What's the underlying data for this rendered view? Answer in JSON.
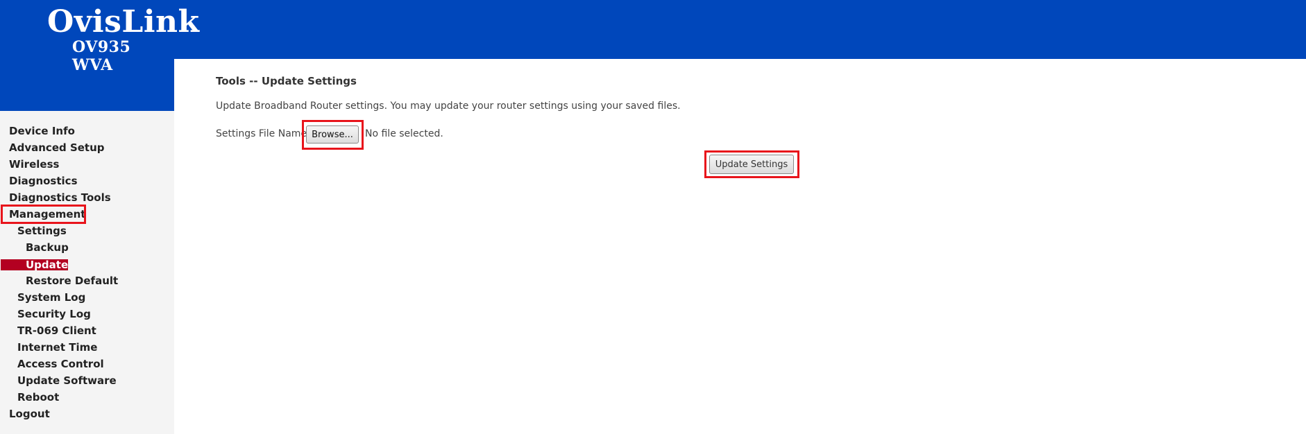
{
  "brand": {
    "name": "OvisLink",
    "model": "OV935 WVA",
    "header_color": "#0047bb"
  },
  "sidebar": {
    "selected_color": "#b30021",
    "highlight_color": "#e8141b",
    "items": [
      {
        "label": "Device Info",
        "level": 0
      },
      {
        "label": "Advanced Setup",
        "level": 0
      },
      {
        "label": "Wireless",
        "level": 0
      },
      {
        "label": "Diagnostics",
        "level": 0
      },
      {
        "label": "Diagnostics Tools",
        "level": 0
      },
      {
        "label": "Management",
        "level": 0,
        "highlighted": true
      },
      {
        "label": "Settings",
        "level": 1
      },
      {
        "label": "Backup",
        "level": 2
      },
      {
        "label": "Update",
        "level": 2,
        "selected": true
      },
      {
        "label": "Restore Default",
        "level": 2
      },
      {
        "label": "System Log",
        "level": 1
      },
      {
        "label": "Security Log",
        "level": 1
      },
      {
        "label": "TR-069 Client",
        "level": 1
      },
      {
        "label": "Internet Time",
        "level": 1
      },
      {
        "label": "Access Control",
        "level": 1
      },
      {
        "label": "Update Software",
        "level": 1
      },
      {
        "label": "Reboot",
        "level": 1
      },
      {
        "label": "Logout",
        "level": 0
      }
    ]
  },
  "main": {
    "title": "Tools -- Update Settings",
    "description": "Update Broadband Router settings. You may update your router settings using your saved files.",
    "file_label": "Settings File Name:",
    "browse_label": "Browse...",
    "file_status": "No file selected.",
    "update_label": "Update Settings",
    "browse_highlighted": true,
    "update_highlighted": true
  }
}
